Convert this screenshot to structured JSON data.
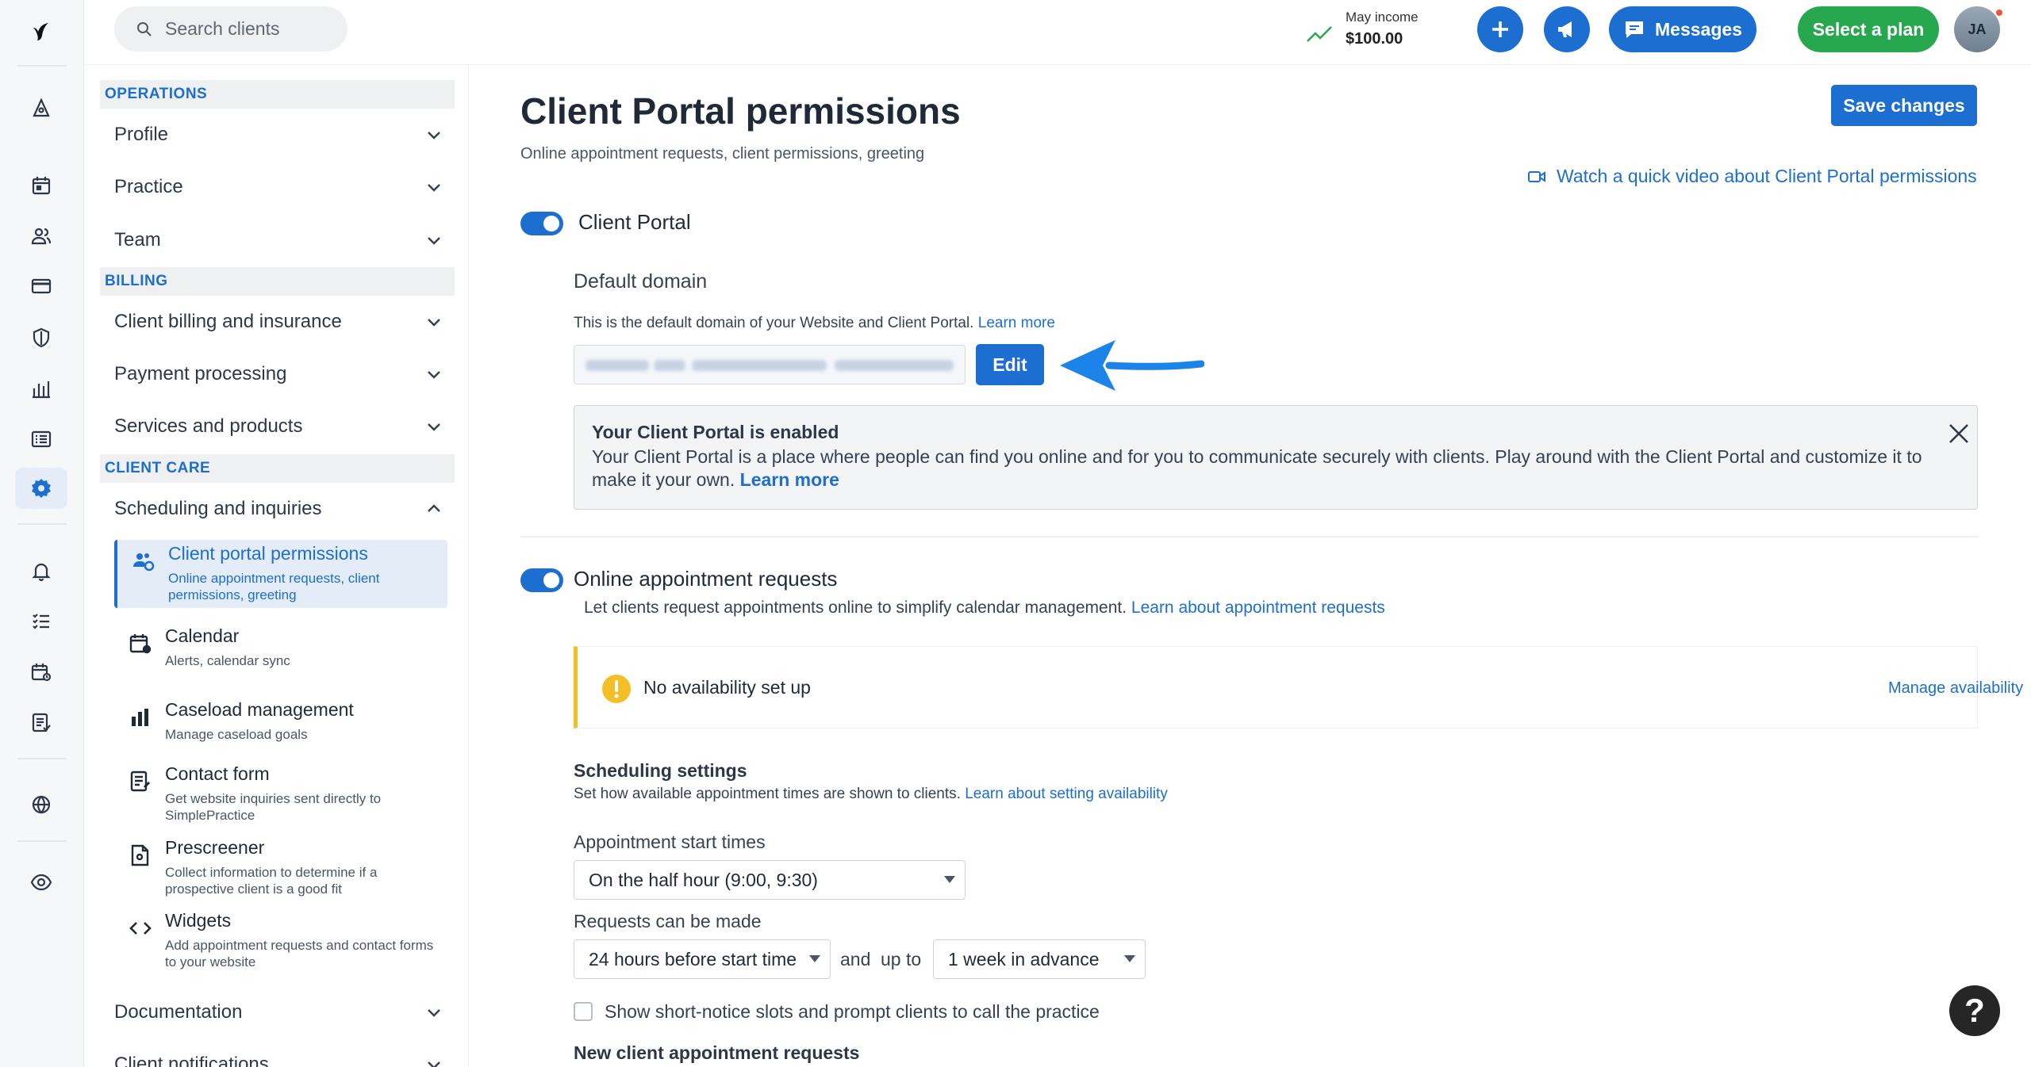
{
  "brand": {
    "logo_icon": "simplepractice-logo-icon"
  },
  "rail": {
    "items": [
      {
        "icon": "home-icon"
      },
      {
        "icon": "calendar-icon"
      },
      {
        "icon": "clients-icon"
      },
      {
        "icon": "billing-icon"
      },
      {
        "icon": "insurance-shield-icon"
      },
      {
        "icon": "analytics-icon"
      },
      {
        "icon": "activity-list-icon"
      },
      {
        "icon": "settings-gear-icon"
      },
      {
        "icon": "reminders-bell-icon"
      },
      {
        "icon": "tasks-icon"
      },
      {
        "icon": "requests-icon"
      },
      {
        "icon": "documents-icon"
      },
      {
        "icon": "website-globe-icon"
      },
      {
        "icon": "client-view-eye-icon"
      }
    ]
  },
  "topbar": {
    "search_placeholder": "Search clients",
    "income_label": "May income",
    "income_value": "$100.00",
    "messages_label": "Messages",
    "plan_label": "Select a plan",
    "avatar_initials": "JA"
  },
  "sidebar": {
    "sections": {
      "operations": "OPERATIONS",
      "billing": "BILLING",
      "client_care": "CLIENT CARE"
    },
    "groups": {
      "profile": "Profile",
      "practice": "Practice",
      "team": "Team",
      "client_billing": "Client billing and insurance",
      "payment_processing": "Payment processing",
      "services_products": "Services and products",
      "scheduling": "Scheduling and inquiries",
      "documentation": "Documentation",
      "client_notifications": "Client notifications"
    },
    "subitems": [
      {
        "title": "Client portal permissions",
        "desc": "Online appointment requests, client permissions, greeting"
      },
      {
        "title": "Calendar",
        "desc": "Alerts, calendar sync"
      },
      {
        "title": "Caseload management",
        "desc": "Manage caseload goals"
      },
      {
        "title": "Contact form",
        "desc": "Get website inquiries sent directly to SimplePractice"
      },
      {
        "title": "Prescreener",
        "desc": "Collect information to determine if a prospective client is a good fit"
      },
      {
        "title": "Widgets",
        "desc": "Add appointment requests and contact forms to your website"
      }
    ]
  },
  "main": {
    "title": "Client Portal permissions",
    "subtitle": "Online appointment requests, client permissions, greeting",
    "save_label": "Save changes",
    "video_link": "Watch a quick video about Client Portal permissions",
    "client_portal": {
      "toggle_label": "Client Portal",
      "enabled": true,
      "domain_heading": "Default domain",
      "domain_help": "This is the default domain of your Website and Client Portal.",
      "domain_help_link": "Learn more",
      "edit_label": "Edit"
    },
    "notice": {
      "title": "Your Client Portal is enabled",
      "body": "Your Client Portal is a place where people can find you online and for you to communicate securely with clients. Play around with the Client Portal and customize it to make it your own.",
      "link": "Learn more"
    },
    "online_requests": {
      "toggle_label": "Online appointment requests",
      "enabled": true,
      "help": "Let clients request appointments online to simplify calendar management.",
      "help_link": "Learn about appointment requests",
      "alert_text": "No availability set up",
      "alert_link": "Manage availability"
    },
    "scheduling": {
      "heading": "Scheduling settings",
      "help": "Set how available appointment times are shown to clients.",
      "help_link": "Learn about setting availability",
      "start_times_label": "Appointment start times",
      "start_times_value": "On the half hour (9:00, 9:30)",
      "requests_label": "Requests can be made",
      "min_notice_value": "24 hours before start time",
      "and_label": "and",
      "up_to_label": "up to",
      "max_advance_value": "1 week in advance",
      "short_notice_label": "Show short-notice slots and prompt clients to call the practice",
      "short_notice_checked": false,
      "new_requests_heading": "New client appointment requests"
    }
  },
  "help_button": "?",
  "colors": {
    "accent": "#1c6ed1",
    "success": "#27a84f",
    "warning": "#f4bf26"
  }
}
